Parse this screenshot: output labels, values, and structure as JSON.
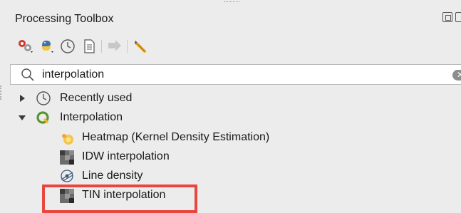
{
  "panel": {
    "title": "Processing Toolbox"
  },
  "toolbar": {
    "icons": [
      "models-icon",
      "python-script-icon",
      "history-icon",
      "results-viewer-icon",
      "edit-features-icon",
      "options-icon"
    ]
  },
  "search": {
    "value": "interpolation"
  },
  "tree": {
    "recent": {
      "label": "Recently used"
    },
    "interpolation": {
      "label": "Interpolation"
    },
    "algorithms": [
      {
        "label": "Heatmap (Kernel Density Estimation)"
      },
      {
        "label": "IDW interpolation"
      },
      {
        "label": "Line density"
      },
      {
        "label": "TIN interpolation"
      }
    ]
  },
  "colors": {
    "highlight": "#e8473f",
    "qgis_green": "#589632"
  }
}
